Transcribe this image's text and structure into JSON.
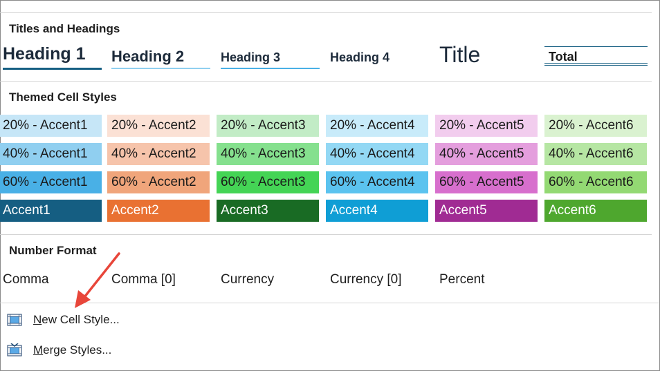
{
  "sections": {
    "titles": "Titles and Headings",
    "themed": "Themed Cell Styles",
    "number": "Number Format"
  },
  "headings": {
    "h1": "Heading 1",
    "h2": "Heading 2",
    "h3": "Heading 3",
    "h4": "Heading 4",
    "title": "Title",
    "total": "Total"
  },
  "themed": {
    "row20": [
      "20% - Accent1",
      "20% - Accent2",
      "20% - Accent3",
      "20% - Accent4",
      "20% - Accent5",
      "20% - Accent6"
    ],
    "row40": [
      "40% - Accent1",
      "40% - Accent2",
      "40% - Accent3",
      "40% - Accent4",
      "40% - Accent5",
      "40% - Accent6"
    ],
    "row60": [
      "60% - Accent1",
      "60% - Accent2",
      "60% - Accent3",
      "60% - Accent4",
      "60% - Accent5",
      "60% - Accent6"
    ],
    "rowAccent": [
      "Accent1",
      "Accent2",
      "Accent3",
      "Accent4",
      "Accent5",
      "Accent6"
    ]
  },
  "colors": {
    "row20": [
      "#c6e6f7",
      "#fbe1d5",
      "#c2ecc6",
      "#c8ebfa",
      "#f2cdee",
      "#daf2d0"
    ],
    "row40": [
      "#90cff0",
      "#f6c4ab",
      "#85e08e",
      "#93d8f4",
      "#e49edd",
      "#b6e6a3"
    ],
    "row60": [
      "#49b0e6",
      "#f0a57b",
      "#44d455",
      "#5bc3ef",
      "#d76fcd",
      "#93d973"
    ],
    "rowAccent": [
      "#155e82",
      "#e97132",
      "#196b24",
      "#0f9ed5",
      "#a02b93",
      "#4ea72e"
    ],
    "arrow": "#e8463a"
  },
  "number_format": [
    "Comma",
    "Comma [0]",
    "Currency",
    "Currency [0]",
    "Percent"
  ],
  "menu": {
    "new_cell_style_ul": "N",
    "new_cell_style_rest": "ew Cell Style...",
    "merge_styles_ul": "M",
    "merge_styles_rest": "erge Styles..."
  }
}
